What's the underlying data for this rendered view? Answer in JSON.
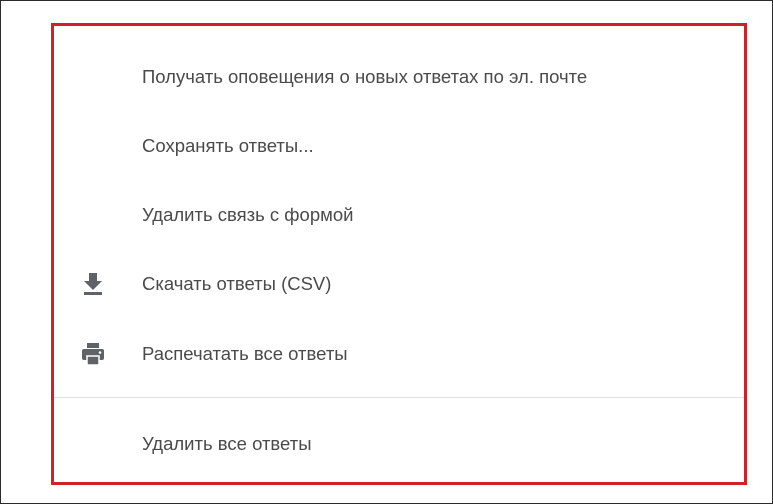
{
  "menu": {
    "items": [
      {
        "label": "Получать оповещения о новых ответах по эл. почте",
        "icon": null
      },
      {
        "label": "Сохранять ответы...",
        "icon": null
      },
      {
        "label": "Удалить связь с формой",
        "icon": null
      },
      {
        "label": "Скачать ответы (CSV)",
        "icon": "download-icon"
      },
      {
        "label": "Распечатать все ответы",
        "icon": "print-icon"
      },
      {
        "label": "Удалить все ответы",
        "icon": null
      }
    ]
  },
  "colors": {
    "highlight_border": "#d0212a",
    "text": "#4a4a4a",
    "icon": "#5f6368",
    "divider": "#e0e0e0"
  }
}
